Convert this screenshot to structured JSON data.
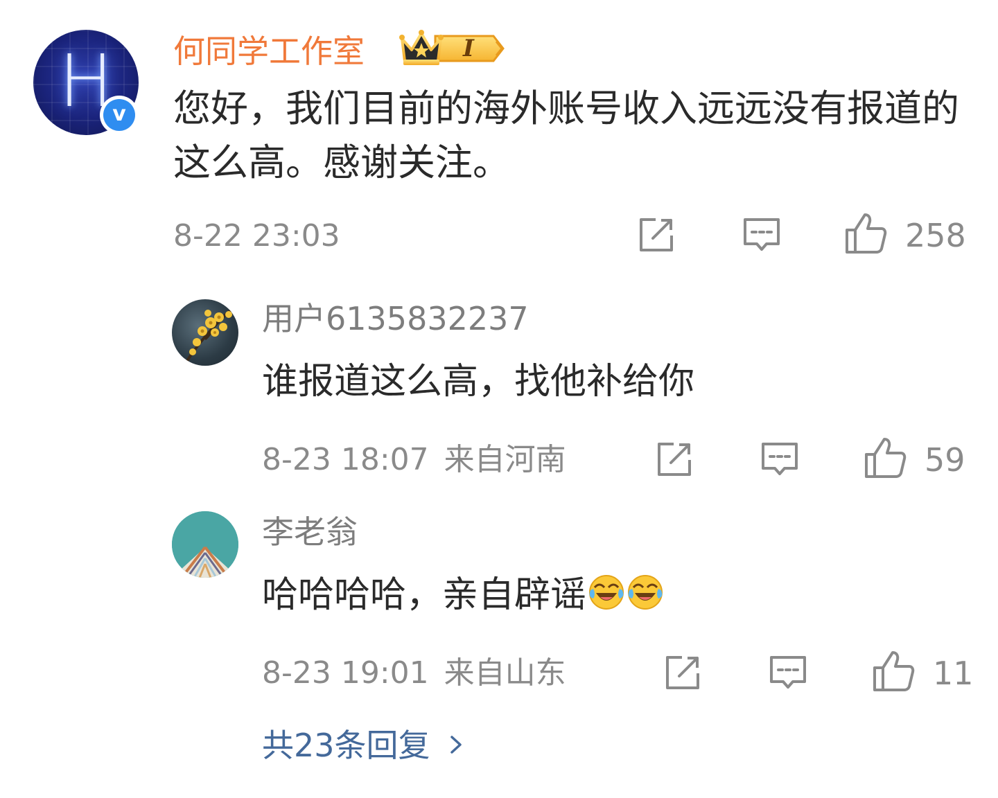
{
  "main_comment": {
    "author": "何同学工作室",
    "badge_level": "I",
    "verified_mark": "v",
    "text": "您好，我们目前的海外账号收入远远没有报道的这么高。感谢关注。",
    "time": "8-22 23:03",
    "likes": "258",
    "avatar_letter": "H"
  },
  "replies": [
    {
      "author": "用户6135832237",
      "text": "谁报道这么高，找他补给你",
      "time": "8-23 18:07",
      "location": "来自河南",
      "likes": "59"
    },
    {
      "author": "李老翁",
      "text": "哈哈哈哈，亲自辟谣",
      "emojis": [
        "laugh-cry-emoji",
        "laugh-cry-emoji"
      ],
      "time": "8-23 19:01",
      "location": "来自山东",
      "likes": "11"
    }
  ],
  "more_replies_label": "共23条回复",
  "icons": {
    "share": "share-icon",
    "comment": "comment-icon",
    "like": "thumbs-up-icon",
    "chevron": "chevron-right-icon"
  },
  "colors": {
    "author_main": "#f0793a",
    "text_primary": "#2a2a2a",
    "text_secondary": "#8a8a8a",
    "link": "#44699a",
    "verified": "#2f8df0"
  }
}
